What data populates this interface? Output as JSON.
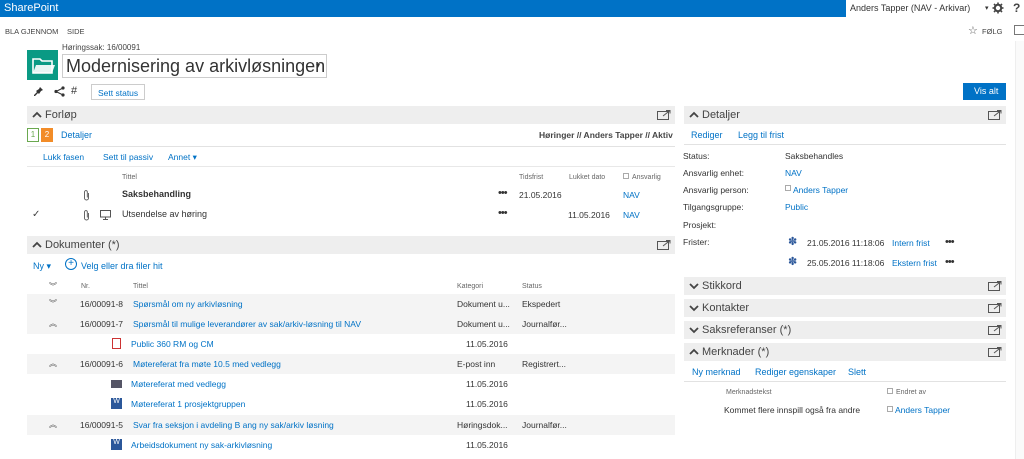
{
  "suite_bar": {
    "brand": "SharePoint",
    "user": "Anders Tapper (NAV - Arkivar)",
    "help": "?"
  },
  "ribbon": {
    "tabs": [
      "BLA GJENNOM",
      "SIDE"
    ],
    "follow": "FØLG"
  },
  "header": {
    "case_label": "Høringssak: 16/00091",
    "title": "Modernisering av arkivløsningen"
  },
  "toolbar": {
    "hash": "#",
    "set_status": "Sett status",
    "show_all": "Vis alt"
  },
  "forlop": {
    "title": "Forløp",
    "steps": [
      "1",
      "2"
    ],
    "details_link": "Detaljer",
    "breadcrumb": "Høringer // Anders Tapper // Aktiv",
    "actions": [
      "Lukk fasen",
      "Sett til passiv",
      "Annet"
    ],
    "columns": {
      "title": "Tittel",
      "deadline": "Tidsfrist",
      "closed": "Lukket dato",
      "responsible": "Ansvarlig"
    },
    "rows": [
      {
        "title": "Saksbehandling",
        "deadline": "21.05.2016",
        "closed": "",
        "responsible": "NAV",
        "check": "",
        "bold": true
      },
      {
        "title": "Utsendelse av høring",
        "deadline": "",
        "closed": "11.05.2016",
        "responsible": "NAV",
        "check": "✓",
        "bold": false
      }
    ],
    "dots": "•••"
  },
  "dokumenter": {
    "title": "Dokumenter (*)",
    "new_label": "Ny",
    "upload_label": "Velg eller dra filer hit",
    "columns": {
      "nr": "Nr.",
      "title": "Tittel",
      "category": "Kategori",
      "status": "Status"
    },
    "rows": [
      {
        "kind": "doc",
        "nr": "16/00091-8",
        "title": "Spørsmål om ny arkivløsning",
        "category": "Dokument u...",
        "status": "Ekspedert",
        "gray": true,
        "expand": "down"
      },
      {
        "kind": "doc",
        "nr": "16/00091-7",
        "title": "Spørsmål til mulige leverandører av sak/arkiv-løsning til NAV",
        "category": "Dokument u...",
        "status": "Journalfør...",
        "gray": true,
        "expand": "up"
      },
      {
        "kind": "file",
        "icon": "pdf",
        "title": "Public 360 RM og CM",
        "date": "11.05.2016"
      },
      {
        "kind": "doc",
        "nr": "16/00091-6",
        "title": "Møtereferat fra møte 10.5 med vedlegg",
        "category": "E-post inn",
        "status": "Registrert...",
        "gray": true,
        "expand": "up"
      },
      {
        "kind": "file",
        "icon": "mail",
        "title": "Møtereferat med vedlegg",
        "date": "11.05.2016"
      },
      {
        "kind": "file",
        "icon": "word",
        "title": "Møtereferat 1 prosjektgruppen",
        "date": "11.05.2016"
      },
      {
        "kind": "doc",
        "nr": "16/00091-5",
        "title": "Svar fra seksjon i avdeling B ang ny sak/arkiv løsning",
        "category": "Høringsdok...",
        "status": "Journalfør...",
        "gray": true,
        "expand": "up"
      },
      {
        "kind": "file",
        "icon": "word",
        "title": "Arbeidsdokument ny sak-arkivløsning",
        "date": "11.05.2016"
      }
    ]
  },
  "detaljer": {
    "title": "Detaljer",
    "actions": [
      "Rediger",
      "Legg til frist"
    ],
    "fields": [
      {
        "label": "Status:",
        "value": "Saksbehandles",
        "link": false
      },
      {
        "label": "Ansvarlig enhet:",
        "value": "NAV",
        "link": true
      },
      {
        "label": "Ansvarlig person:",
        "value": "Anders Tapper",
        "link": true
      },
      {
        "label": "Tilgangsgruppe:",
        "value": "Public",
        "link": true
      },
      {
        "label": "Prosjekt:",
        "value": "",
        "link": false
      },
      {
        "label": "Frister:",
        "value": "",
        "link": false
      }
    ],
    "deadlines": [
      {
        "date": "21.05.2016 11:18:06",
        "name": "Intern frist"
      },
      {
        "date": "25.05.2016 11:18:06",
        "name": "Ekstern frist"
      }
    ]
  },
  "collapsed_sections": [
    "Stikkord",
    "Kontakter",
    "Saksreferanser (*)"
  ],
  "merknader": {
    "title": "Merknader (*)",
    "actions": [
      "Ny merknad",
      "Rediger egenskaper",
      "Slett"
    ],
    "columns": {
      "text": "Merknadstekst",
      "changed_by": "Endret av"
    },
    "rows": [
      {
        "text": "Kommet flere innspill også fra andre",
        "changed_by": "Anders Tapper"
      }
    ]
  },
  "colors": {
    "brand_blue": "#0072c6",
    "step2_orange": "#f28c28",
    "step1_green": "#6aa84f",
    "pdf_red": "#cc3333",
    "word_blue": "#2b579a"
  }
}
